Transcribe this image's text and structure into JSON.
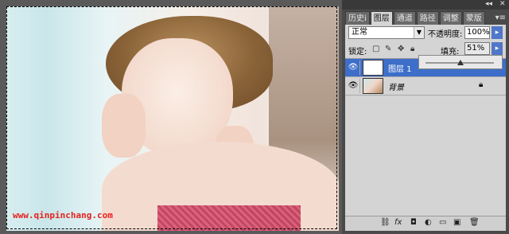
{
  "canvas": {
    "watermark": "www.qinpinchang.com"
  },
  "panel": {
    "tabs": [
      {
        "label": "历史i"
      },
      {
        "label": "图层"
      },
      {
        "label": "通道"
      },
      {
        "label": "路径"
      },
      {
        "label": "调整"
      },
      {
        "label": "蒙版"
      }
    ],
    "active_tab": "图层",
    "topbar_controls": "◂◂",
    "topbar_close": "✕",
    "menu_icon": "▾≡",
    "blend_mode": "正常",
    "opacity_label": "不透明度:",
    "opacity_value": "100%",
    "lock_label": "锁定:",
    "fill_label": "填充:",
    "fill_value": "51%",
    "fill_slider_level": 0.51,
    "layers": [
      {
        "name": "图层 1",
        "selected": true,
        "locked": false
      },
      {
        "name": "背景",
        "selected": false,
        "locked": true
      }
    ]
  },
  "colors": {
    "selection": "#3d6ec9",
    "watermark": "#e5211c"
  }
}
